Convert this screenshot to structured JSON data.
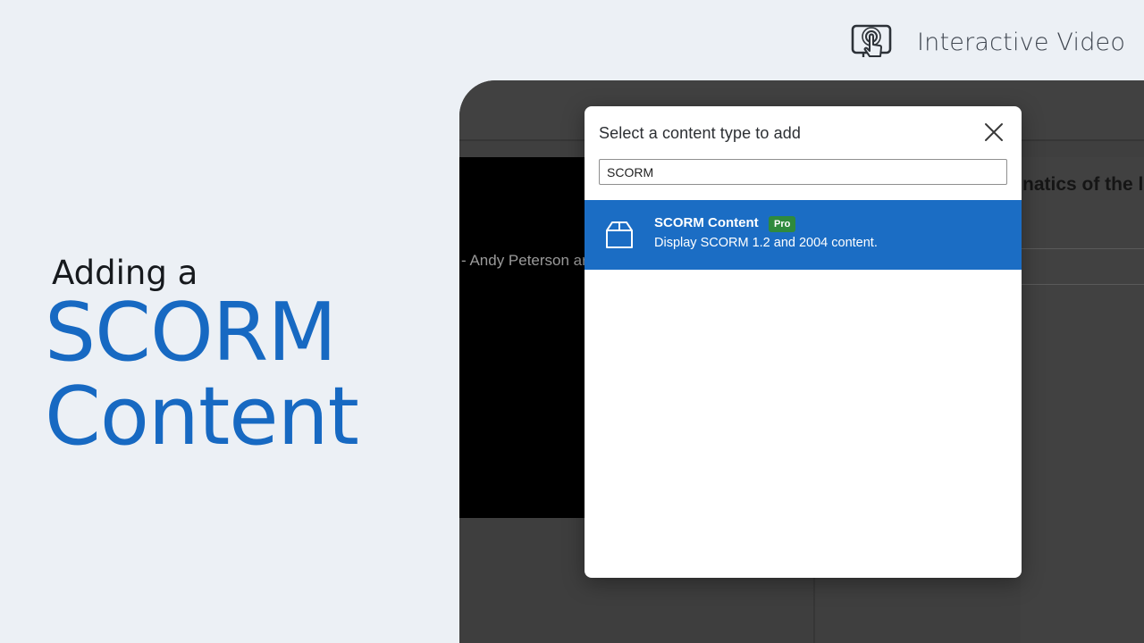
{
  "brand": {
    "title": "Interactive Video",
    "icon": "touch-screen-icon"
  },
  "hero": {
    "subtitle": "Adding a",
    "line1": "SCORM",
    "line2": "Content"
  },
  "background_app": {
    "video_title_fragment": "- Andy Peterson ar",
    "right_heading_fragment": "natics of the le"
  },
  "modal": {
    "title": "Select a content type to add",
    "search_value": "SCORM",
    "results": [
      {
        "name": "SCORM Content",
        "badge": "Pro",
        "description": "Display SCORM 1.2 and 2004 content.",
        "icon": "box-icon"
      }
    ]
  },
  "colors": {
    "accent": "#1769c2",
    "selected_row": "#1b6dc4",
    "pro_badge": "#2f8a3d",
    "page_background": "#ecf0f5",
    "app_background": "#3f3f3f"
  }
}
